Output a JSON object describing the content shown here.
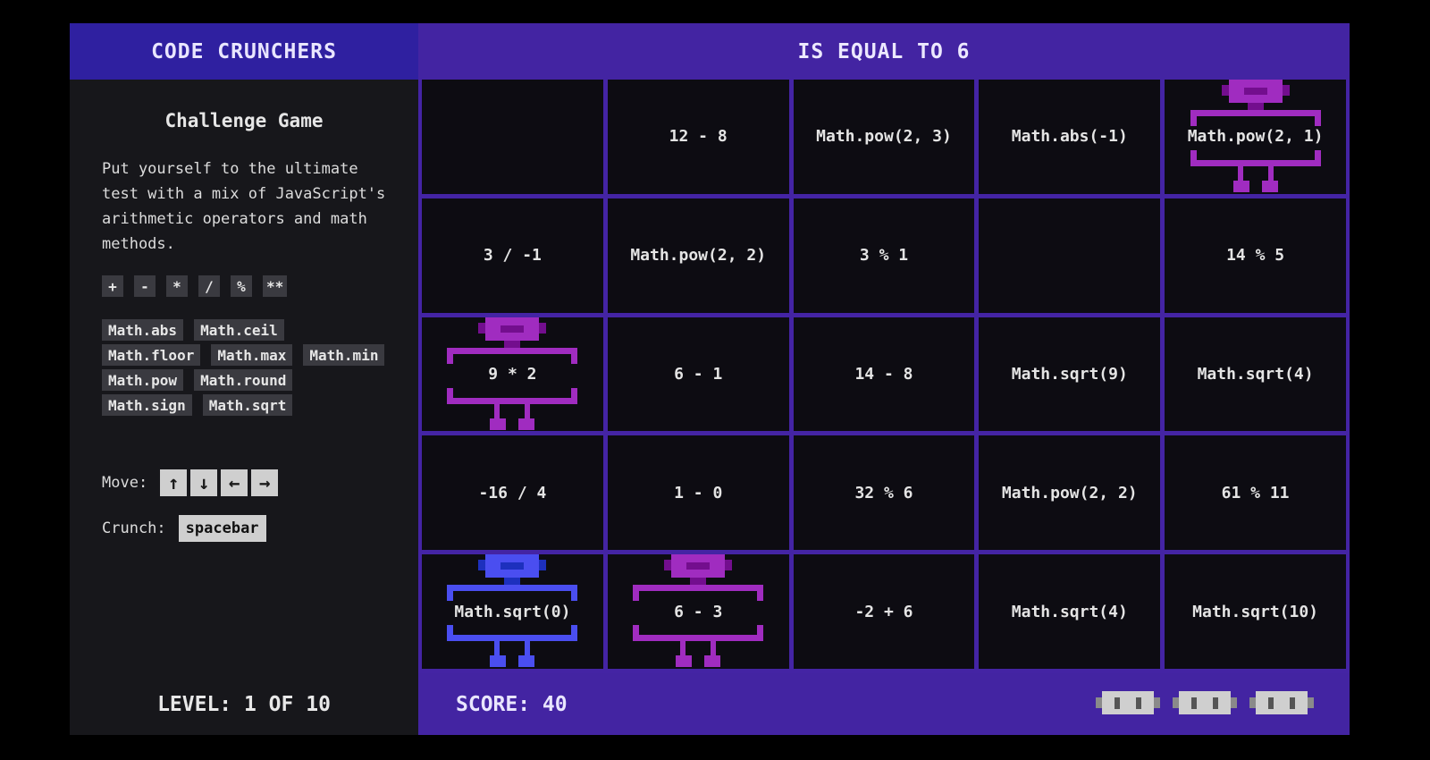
{
  "app": {
    "title": "CODE CRUNCHERS",
    "target": "IS EQUAL TO 6"
  },
  "sidebar": {
    "heading": "Challenge Game",
    "description": "Put yourself to the ultimate test with a mix of JavaScript's arithmetic operators and math methods.",
    "operators": [
      "+",
      "-",
      "*",
      "/",
      "%",
      "**"
    ],
    "math_methods": [
      "Math.abs",
      "Math.ceil",
      "Math.floor",
      "Math.max",
      "Math.min",
      "Math.pow",
      "Math.round",
      "Math.sign",
      "Math.sqrt"
    ],
    "move_label": "Move:",
    "move_keys": [
      "↑",
      "↓",
      "←",
      "→"
    ],
    "crunch_label": "Crunch:",
    "crunch_key": "spacebar"
  },
  "board": {
    "rows": [
      [
        "",
        "12 - 8",
        "Math.pow(2, 3)",
        "Math.abs(-1)",
        "Math.pow(2, 1)"
      ],
      [
        "3 / -1",
        "Math.pow(2, 2)",
        "3 % 1",
        "",
        "14 % 5"
      ],
      [
        "9 * 2",
        "6 - 1",
        "14 - 8",
        "Math.sqrt(9)",
        "Math.sqrt(4)"
      ],
      [
        "-16 / 4",
        "1 - 0",
        "32 % 6",
        "Math.pow(2, 2)",
        "61 % 11"
      ],
      [
        "Math.sqrt(0)",
        "6 - 3",
        "-2 + 6",
        "Math.sqrt(4)",
        "Math.sqrt(10)"
      ]
    ],
    "player": {
      "row": 4,
      "col": 0,
      "color": "#4a4ef0"
    },
    "enemies": [
      {
        "row": 0,
        "col": 4,
        "color": "#a02cc0"
      },
      {
        "row": 2,
        "col": 0,
        "color": "#a02cc0"
      },
      {
        "row": 4,
        "col": 1,
        "color": "#a02cc0"
      }
    ]
  },
  "footer": {
    "level": "LEVEL: 1 OF 10",
    "score": "SCORE: 40",
    "lives": 3
  }
}
